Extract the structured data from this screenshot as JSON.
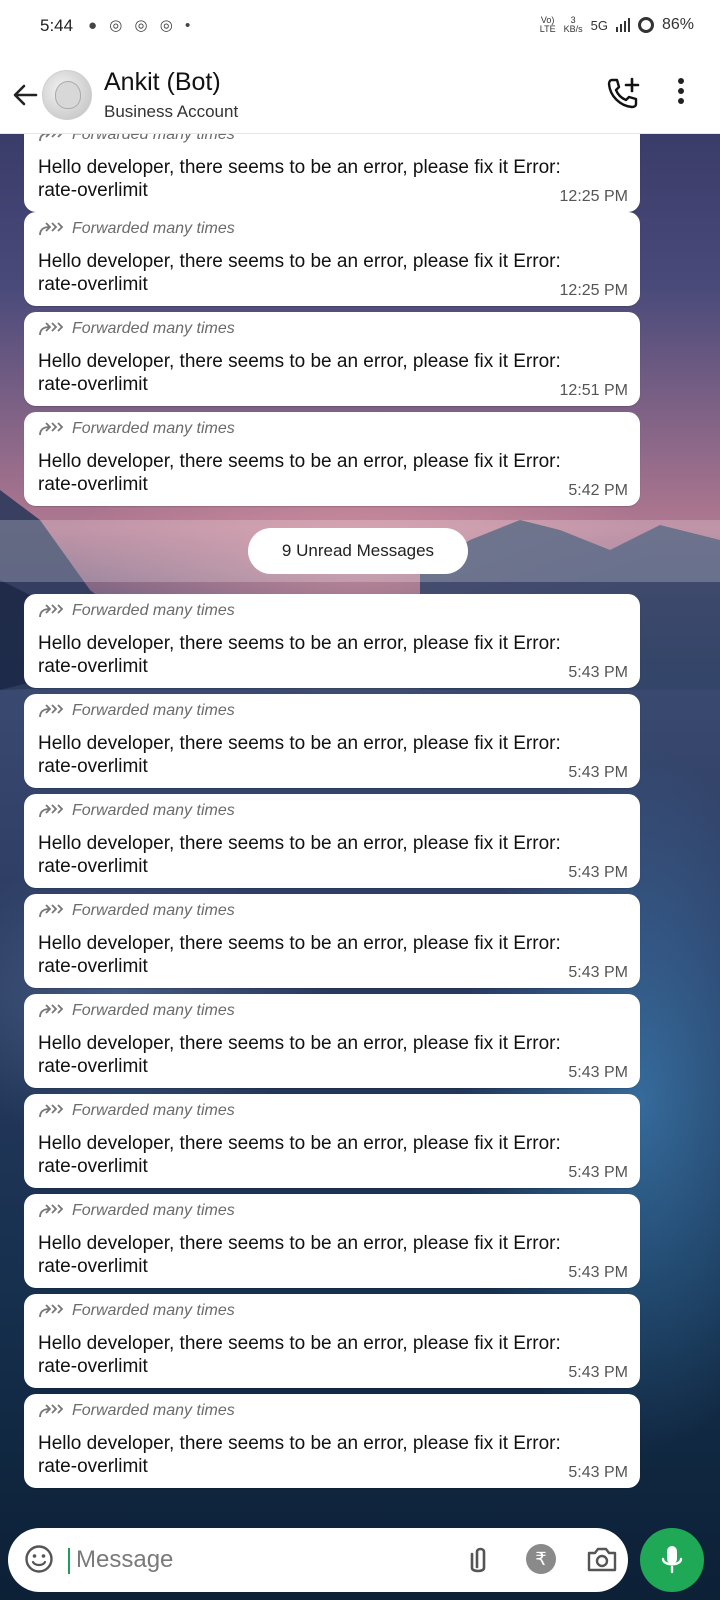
{
  "status_bar": {
    "time": "5:44",
    "left_icons": "● ◎ ◎ ◎ •",
    "network_top": "Vo)",
    "network_bottom": "LTE",
    "speed_top": "3",
    "speed_bottom": "KB/s",
    "signal": "5G",
    "battery": "86%"
  },
  "header": {
    "name": "Ankit (Bot)",
    "subtitle": "Business Account"
  },
  "messages_before": [
    {
      "forwarded": "Forwarded many times",
      "text": "Hello developer, there seems to be an error, please fix it Error: rate-overlimit",
      "time": "12:25 PM"
    },
    {
      "forwarded": "Forwarded many times",
      "text": "Hello developer, there seems to be an error, please fix it Error: rate-overlimit",
      "time": "12:25 PM"
    },
    {
      "forwarded": "Forwarded many times",
      "text": "Hello developer, there seems to be an error, please fix it Error: rate-overlimit",
      "time": "12:51 PM"
    },
    {
      "forwarded": "Forwarded many times",
      "text": "Hello developer, there seems to be an error, please fix it Error: rate-overlimit",
      "time": "5:42 PM"
    }
  ],
  "unread_label": "9 Unread Messages",
  "messages_after": [
    {
      "forwarded": "Forwarded many times",
      "text": "Hello developer, there seems to be an error, please fix it Error: rate-overlimit",
      "time": "5:43 PM"
    },
    {
      "forwarded": "Forwarded many times",
      "text": "Hello developer, there seems to be an error, please fix it Error: rate-overlimit",
      "time": "5:43 PM"
    },
    {
      "forwarded": "Forwarded many times",
      "text": "Hello developer, there seems to be an error, please fix it Error: rate-overlimit",
      "time": "5:43 PM"
    },
    {
      "forwarded": "Forwarded many times",
      "text": "Hello developer, there seems to be an error, please fix it Error: rate-overlimit",
      "time": "5:43 PM"
    },
    {
      "forwarded": "Forwarded many times",
      "text": "Hello developer, there seems to be an error, please fix it Error: rate-overlimit",
      "time": "5:43 PM"
    },
    {
      "forwarded": "Forwarded many times",
      "text": "Hello developer, there seems to be an error, please fix it Error: rate-overlimit",
      "time": "5:43 PM"
    },
    {
      "forwarded": "Forwarded many times",
      "text": "Hello developer, there seems to be an error, please fix it Error: rate-overlimit",
      "time": "5:43 PM"
    },
    {
      "forwarded": "Forwarded many times",
      "text": "Hello developer, there seems to be an error, please fix it Error: rate-overlimit",
      "time": "5:43 PM"
    },
    {
      "forwarded": "Forwarded many times",
      "text": "Hello developer, there seems to be an error, please fix it Error: rate-overlimit",
      "time": "5:43 PM"
    }
  ],
  "input": {
    "placeholder": "Message",
    "rupee_symbol": "₹"
  },
  "icons": {
    "back": "back-arrow-icon",
    "call_add": "add-call-icon",
    "more": "more-vert-icon",
    "forward": "forward-icon",
    "emoji": "emoji-icon",
    "attach": "attach-icon",
    "payment": "rupee-icon",
    "camera": "camera-icon",
    "mic": "mic-icon"
  },
  "colors": {
    "accent_green": "#1fa855",
    "bubble_bg": "#ffffff"
  }
}
